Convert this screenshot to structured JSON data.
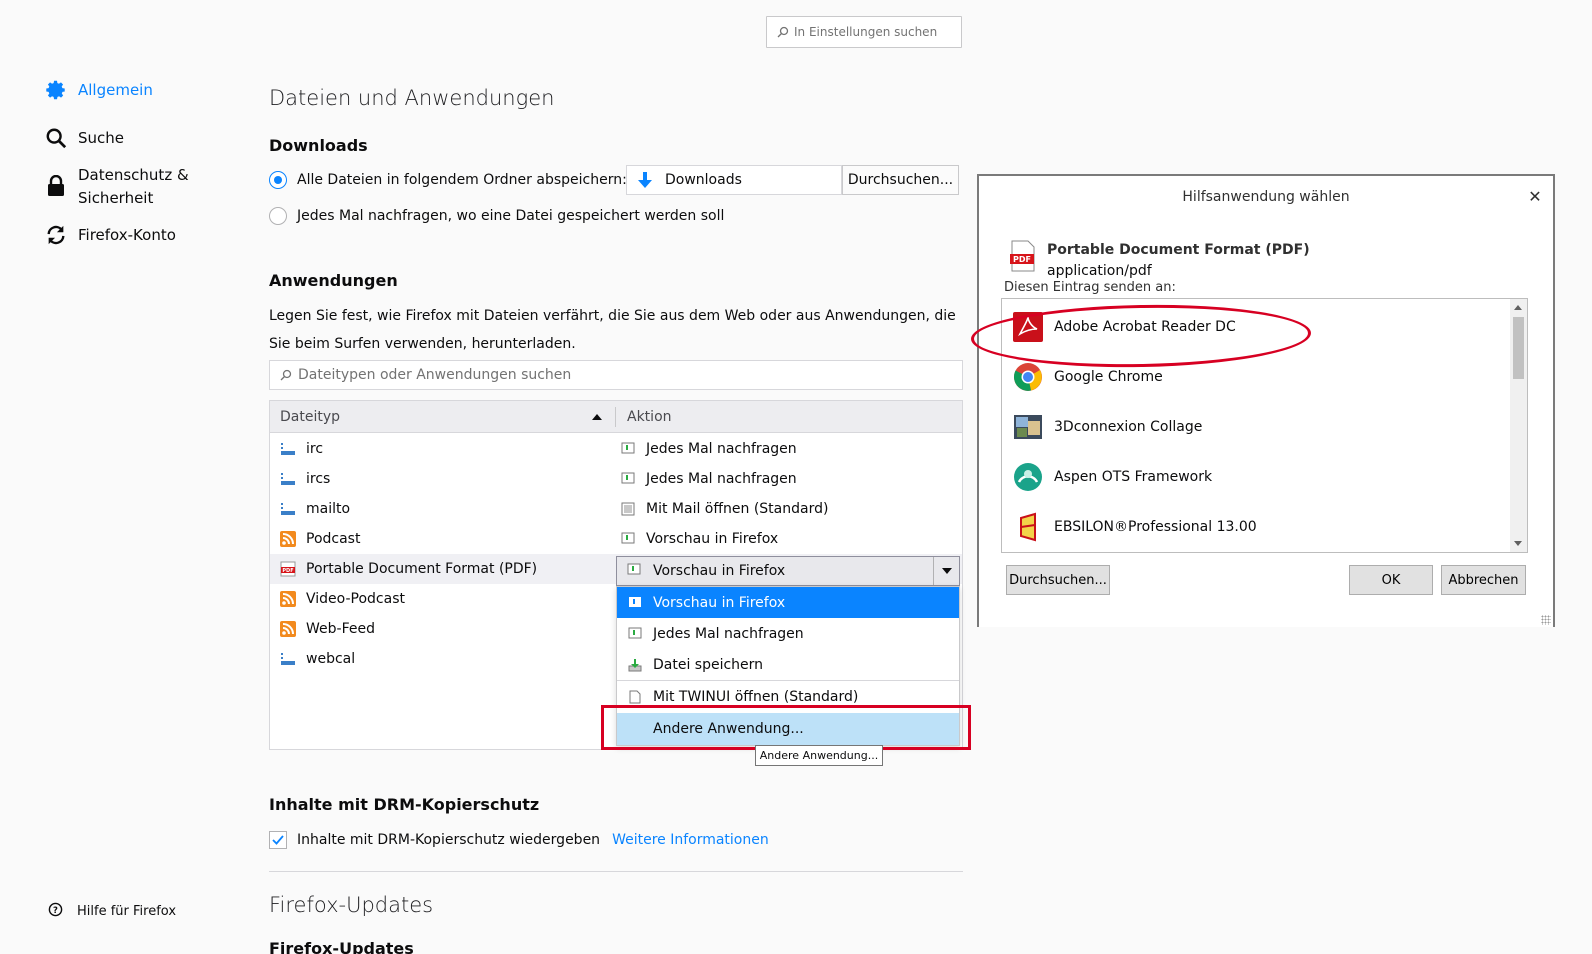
{
  "search": {
    "placeholder": "In Einstellungen suchen"
  },
  "sidebar": {
    "items": [
      {
        "label": "Allgemein",
        "icon": "gear-icon",
        "active": true
      },
      {
        "label": "Suche",
        "icon": "search-icon"
      },
      {
        "label": "Datenschutz &",
        "label2": "Sicherheit",
        "icon": "lock-icon"
      },
      {
        "label": "Firefox-Konto",
        "icon": "sync-icon"
      }
    ],
    "help": "Hilfe für Firefox"
  },
  "main": {
    "title": "Dateien und Anwendungen",
    "downloads": {
      "heading": "Downloads",
      "option_save": "Alle Dateien in folgendem Ordner abspeichern:",
      "folder": "Downloads",
      "browse": "Durchsuchen...",
      "option_ask": "Jedes Mal nachfragen, wo eine Datei gespeichert werden soll"
    },
    "applications": {
      "heading": "Anwendungen",
      "description": "Legen Sie fest, wie Firefox mit Dateien verfährt, die Sie aus dem Web oder aus Anwendungen, die Sie beim Surfen verwenden, herunterladen.",
      "filter_placeholder": "Dateitypen oder Anwendungen suchen",
      "columns": [
        "Dateityp",
        "Aktion"
      ],
      "rows": [
        {
          "type": "irc",
          "action": "Jedes Mal nachfragen"
        },
        {
          "type": "ircs",
          "action": "Jedes Mal nachfragen"
        },
        {
          "type": "mailto",
          "action": "Mit Mail öffnen (Standard)"
        },
        {
          "type": "Podcast",
          "action": "Vorschau in Firefox"
        },
        {
          "type": "Portable Document Format (PDF)",
          "action": "Vorschau in Firefox"
        },
        {
          "type": "Video-Podcast",
          "action": ""
        },
        {
          "type": "Web-Feed",
          "action": ""
        },
        {
          "type": "webcal",
          "action": ""
        }
      ],
      "dropdown": [
        "Vorschau in Firefox",
        "Jedes Mal nachfragen",
        "Datei speichern",
        "Mit TWINUI öffnen (Standard)",
        "Andere Anwendung..."
      ],
      "tooltip": "Andere Anwendung..."
    },
    "drm": {
      "heading": "Inhalte mit DRM-Kopierschutz",
      "checkbox": "Inhalte mit DRM-Kopierschutz wiedergeben",
      "link": "Weitere Informationen"
    },
    "updates": {
      "title": "Firefox-Updates",
      "heading": "Firefox-Updates"
    }
  },
  "dialog": {
    "title": "Hilfsanwendung wählen",
    "file_type": "Portable Document Format (PDF)",
    "mime": "application/pdf",
    "send_to": "Diesen Eintrag senden an:",
    "apps": [
      "Adobe Acrobat Reader DC",
      "Google Chrome",
      "3Dconnexion Collage",
      "Aspen OTS Framework",
      "EBSILON®Professional 13.00"
    ],
    "browse": "Durchsuchen...",
    "ok": "OK",
    "cancel": "Abbrechen"
  },
  "colors": {
    "accent": "#0a84ff",
    "highlight": "#d70022"
  }
}
